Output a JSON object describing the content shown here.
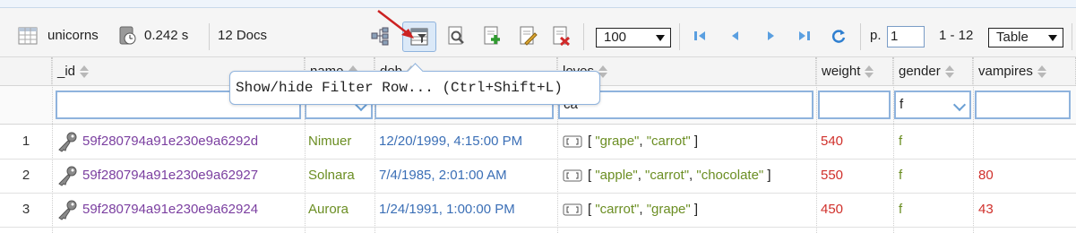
{
  "toolbar": {
    "collection": "unicorns",
    "time": "0.242 s",
    "doc_count": "12 Docs",
    "page_size": "100",
    "page_label": "p.",
    "page_value": "1",
    "range": "1 - 12",
    "view_mode": "Table"
  },
  "tooltip": {
    "text": "Show/hide Filter Row... (Ctrl+Shift+L)"
  },
  "columns": [
    "_id",
    "name",
    "dob",
    "loves",
    "weight",
    "gender",
    "vampires"
  ],
  "filters": {
    "loves": "ca",
    "gender": "f"
  },
  "rows": [
    {
      "n": "1",
      "id": "59f280794a91e230e9a6292d",
      "name": "Nimuer",
      "dob": "12/20/1999, 4:15:00 PM",
      "loves": [
        "\"grape\"",
        "\"carrot\""
      ],
      "weight": "540",
      "gender": "f",
      "vampires": ""
    },
    {
      "n": "2",
      "id": "59f280794a91e230e9a62927",
      "name": "Solnara",
      "dob": "7/4/1985, 2:01:00 AM",
      "loves": [
        "\"apple\"",
        "\"carrot\"",
        "\"chocolate\""
      ],
      "weight": "550",
      "gender": "f",
      "vampires": "80"
    },
    {
      "n": "3",
      "id": "59f280794a91e230e9a62924",
      "name": "Aurora",
      "dob": "1/24/1991, 1:00:00 PM",
      "loves": [
        "\"carrot\"",
        "\"grape\""
      ],
      "weight": "450",
      "gender": "f",
      "vampires": "43"
    }
  ],
  "colors": {
    "id": "#7b3fa0",
    "string": "#6b8e23",
    "date": "#3b6fb6",
    "number": "#d0302b",
    "accent": "#2f7fd0",
    "annotation": "#cc2222"
  },
  "icons": [
    "table-icon",
    "clock-icon",
    "schema-icon",
    "filter-row-icon",
    "query-icon",
    "add-document-icon",
    "edit-document-icon",
    "delete-document-icon",
    "first-page-icon",
    "prev-page-icon",
    "next-page-icon",
    "last-page-icon",
    "refresh-icon",
    "key-icon",
    "array-icon"
  ]
}
